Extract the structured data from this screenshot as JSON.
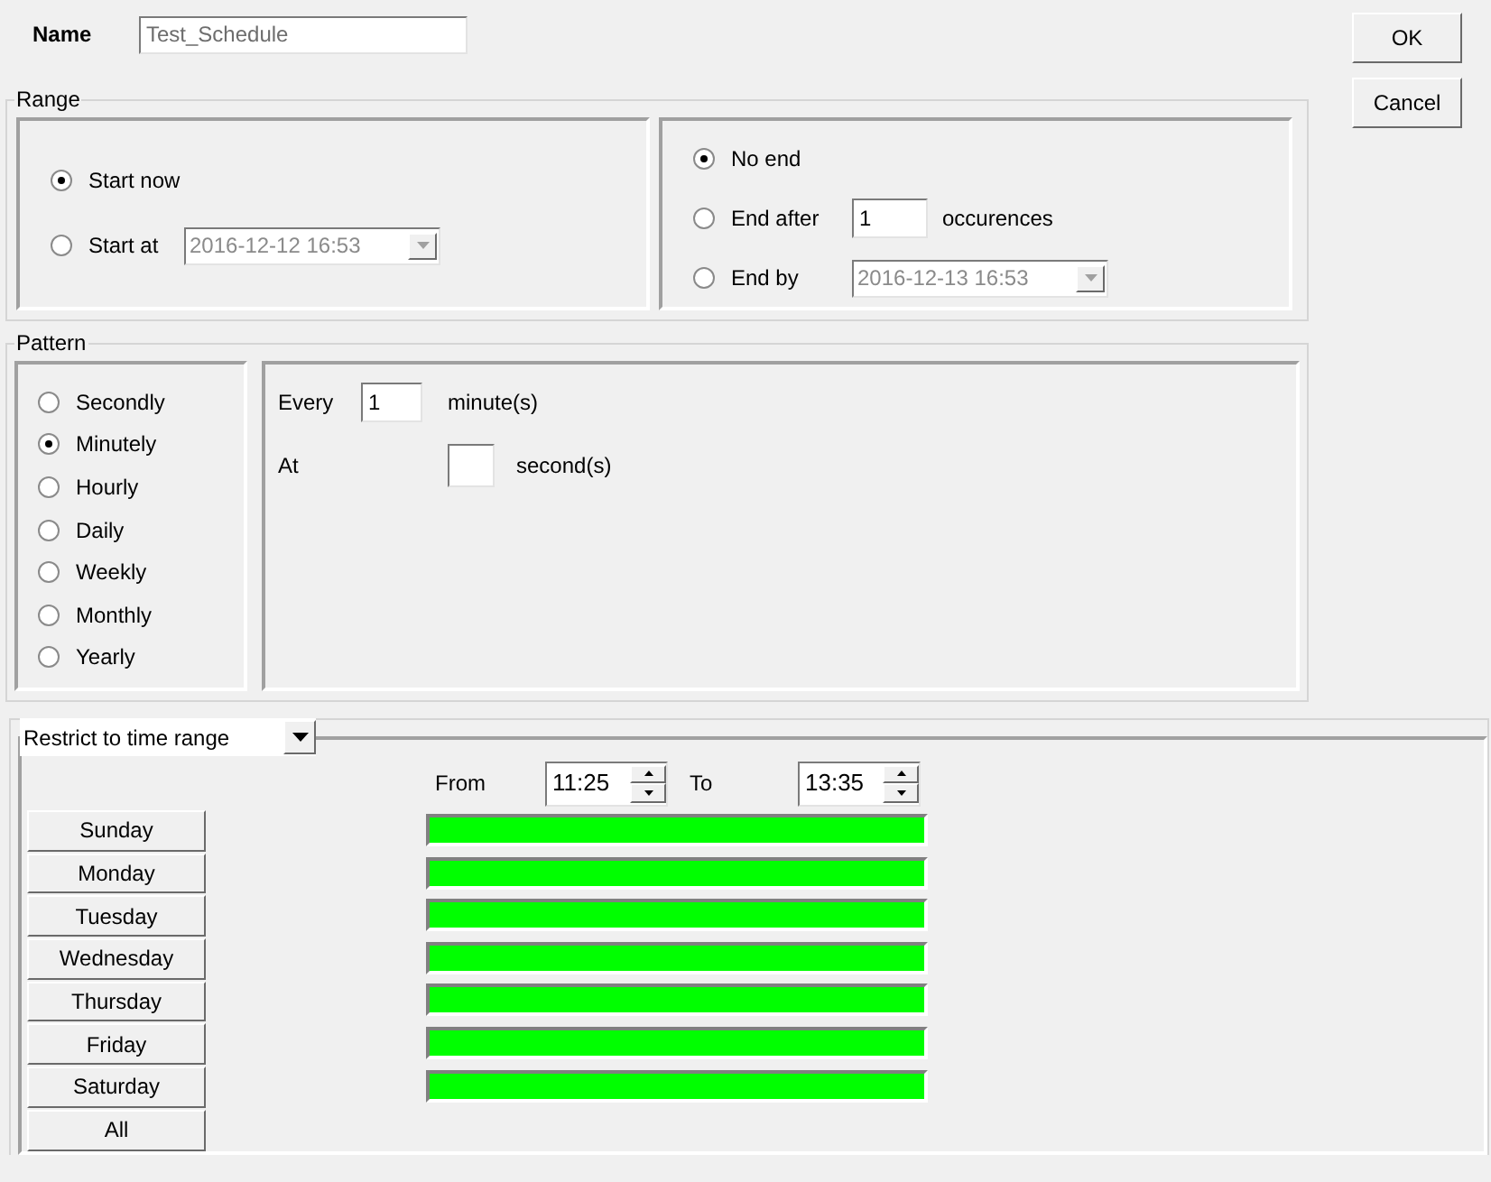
{
  "name_field": {
    "label": "Name",
    "value": "Test_Schedule"
  },
  "buttons": [
    "OK",
    "Cancel"
  ],
  "range": {
    "title": "Range",
    "start_options": [
      {
        "kind": "plain",
        "label": "Start now",
        "selected": true
      },
      {
        "kind": "datetime",
        "label": "Start at",
        "value": "2016-12-12 16:53",
        "disabled": true,
        "selected": false
      }
    ],
    "end_options": [
      {
        "kind": "plain",
        "label": "No end",
        "selected": true
      },
      {
        "kind": "count",
        "label": "End after",
        "value": "1",
        "suffix": "occurences",
        "selected": false
      },
      {
        "kind": "datetime",
        "label": "End by",
        "value": "2016-12-13 16:53",
        "disabled": true,
        "selected": false
      }
    ]
  },
  "pattern": {
    "title": "Pattern",
    "options": [
      {
        "label": "Secondly",
        "selected": false
      },
      {
        "label": "Minutely",
        "selected": true
      },
      {
        "label": "Hourly",
        "selected": false
      },
      {
        "label": "Daily",
        "selected": false
      },
      {
        "label": "Weekly",
        "selected": false
      },
      {
        "label": "Monthly",
        "selected": false
      },
      {
        "label": "Yearly",
        "selected": false
      }
    ],
    "every": {
      "label": "Every",
      "value": "1",
      "unit": "minute(s)"
    },
    "at": {
      "label": "At",
      "unit": "second(s)"
    }
  },
  "restrict": {
    "mode": "Restrict to time range",
    "from_label": "From",
    "from": "11:25",
    "to_label": "To",
    "to": "13:35",
    "days": [
      {
        "label": "Sunday",
        "active": true
      },
      {
        "label": "Monday",
        "active": true
      },
      {
        "label": "Tuesday",
        "active": true
      },
      {
        "label": "Wednesday",
        "active": true
      },
      {
        "label": "Thursday",
        "active": true
      },
      {
        "label": "Friday",
        "active": true
      },
      {
        "label": "Saturday",
        "active": true
      }
    ],
    "all_button": "All"
  }
}
